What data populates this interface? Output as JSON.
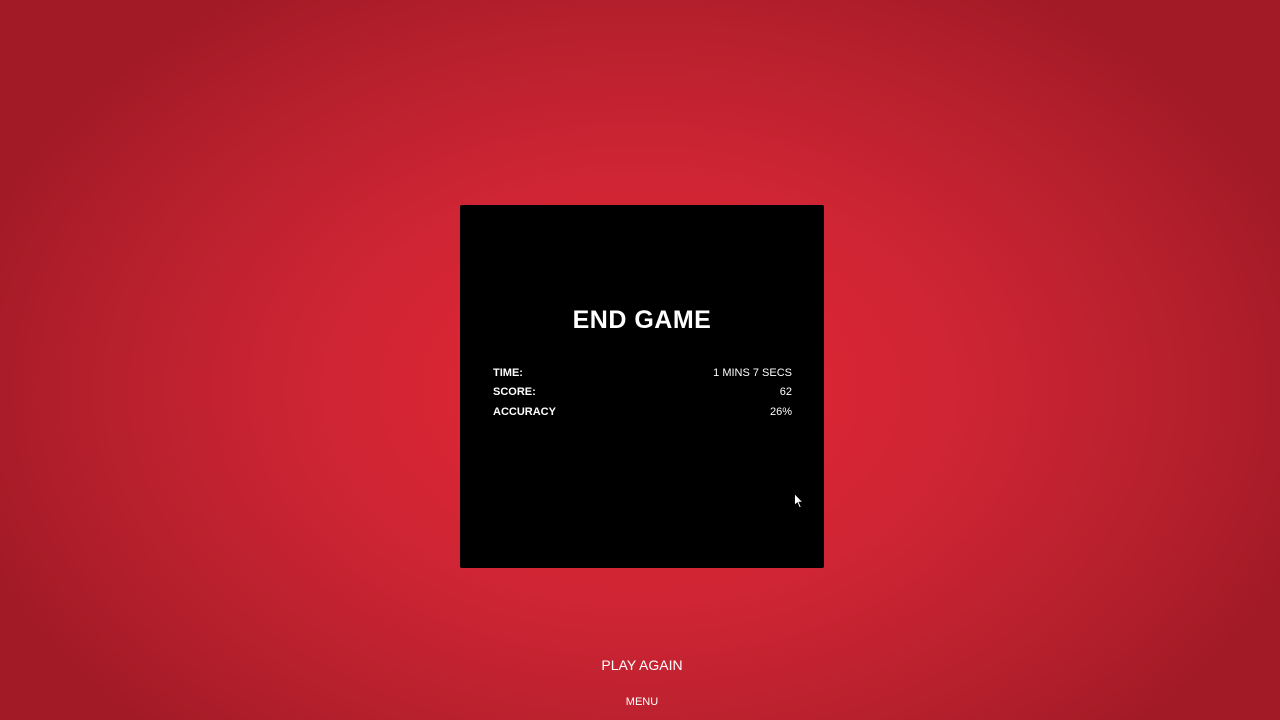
{
  "panel": {
    "title": "END GAME",
    "stats": [
      {
        "label": "TIME:",
        "value": "1 MINS 7 SECS"
      },
      {
        "label": "SCORE:",
        "value": "62"
      },
      {
        "label": "ACCURACY",
        "value": "26%"
      }
    ]
  },
  "actions": {
    "play_again": "PLAY AGAIN",
    "menu": "MENU"
  },
  "colors": {
    "background": "#d92432",
    "panel": "#000000",
    "text": "#ffffff"
  },
  "icons": {
    "cursor": "mouse-pointer-icon"
  }
}
